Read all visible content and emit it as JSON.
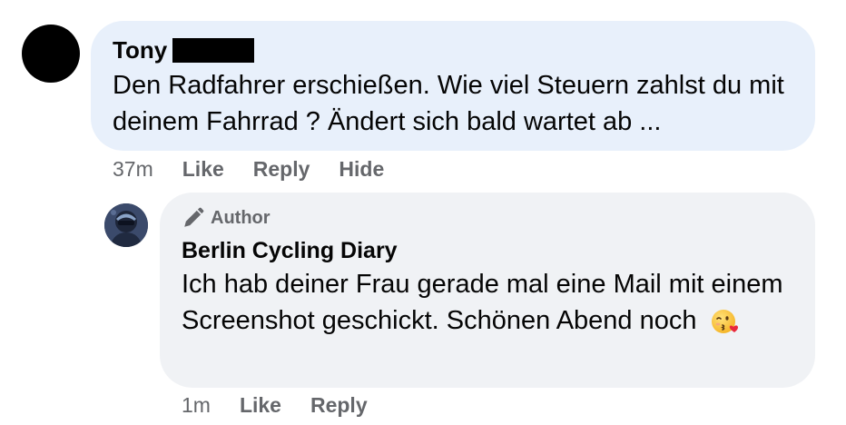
{
  "comment": {
    "author": "Tony",
    "text": "Den Radfahrer erschießen. Wie viel Steuern zahlst du mit deinem Fahrrad ? Ändert sich bald wartet ab ...",
    "time": "37m",
    "actions": {
      "like": "Like",
      "reply": "Reply",
      "hide": "Hide"
    }
  },
  "reply": {
    "badge": "Author",
    "badge_icon": "pencil-icon",
    "author": "Berlin Cycling Diary",
    "text": "Ich hab deiner Frau gerade mal eine Mail mit einem Screenshot geschickt. Schönen Abend noch",
    "emoji_icon": "kissing-wink-emoji-icon",
    "time": "1m",
    "actions": {
      "like": "Like",
      "reply": "Reply"
    }
  },
  "colors": {
    "comment_bubble": "#e8f0fb",
    "reply_bubble": "#f0f2f5",
    "secondary_text": "#65676b"
  }
}
